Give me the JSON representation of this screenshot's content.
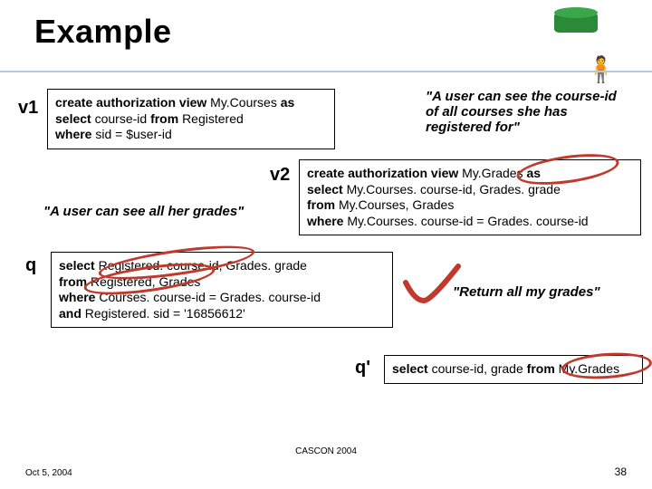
{
  "title": "Example",
  "labels": {
    "v1": "v1",
    "v2": "v2",
    "q": "q",
    "qprime": "q'"
  },
  "v1": {
    "line1_pre": "create authorization view ",
    "line1_name": "My.Courses ",
    "line1_as": "as",
    "line2_pre": "select ",
    "line2_mid": "course-id ",
    "line2_from": "from ",
    "line2_tbl": "Registered",
    "line3_pre": "where ",
    "line3_rest": "sid = $user-id"
  },
  "v1_caption": "\"A user can see the course-id of all courses she has registered for\"",
  "v2": {
    "line1_pre": "create authorization view ",
    "line1_name": "My.Grades ",
    "line1_as": "as",
    "line2_pre": "select ",
    "line2_rest": "My.Courses. course-id, Grades. grade",
    "line3_pre": "from ",
    "line3_rest": "My.Courses, Grades",
    "line4_pre": "where ",
    "line4_rest": "My.Courses. course-id = Grades. course-id"
  },
  "v2_caption": "\"A user can see all her grades\"",
  "q": {
    "line1_pre": "select ",
    "line1_rest": "Registered. course-id, Grades. grade",
    "line2_pre": "from ",
    "line2_rest": "Registered, Grades",
    "line3_pre": "where ",
    "line3_rest": "Courses. course-id = Grades. course-id",
    "line4_pre": "and ",
    "line4_rest": "Registered. sid = '16856612'"
  },
  "q_caption": "\"Return all my grades\"",
  "qprime": {
    "pre1": "select ",
    "mid": "course-id, grade ",
    "pre2": "from ",
    "rest": "My.Grades"
  },
  "footer": {
    "left": "Oct 5, 2004",
    "center": "CASCON 2004",
    "right": "38"
  }
}
